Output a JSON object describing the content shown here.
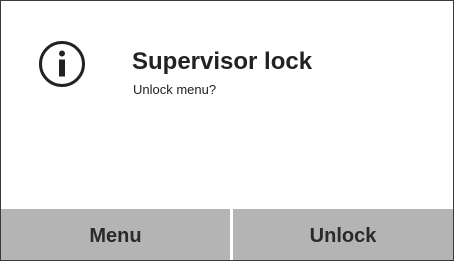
{
  "dialog": {
    "icon": "info-icon",
    "title": "Supervisor lock",
    "message": "Unlock menu?"
  },
  "buttons": {
    "menu_label": "Menu",
    "unlock_label": "Unlock"
  },
  "colors": {
    "background": "#ffffff",
    "button_background": "#b4b4b4",
    "text": "#222222",
    "border": "#3a3a3a"
  }
}
